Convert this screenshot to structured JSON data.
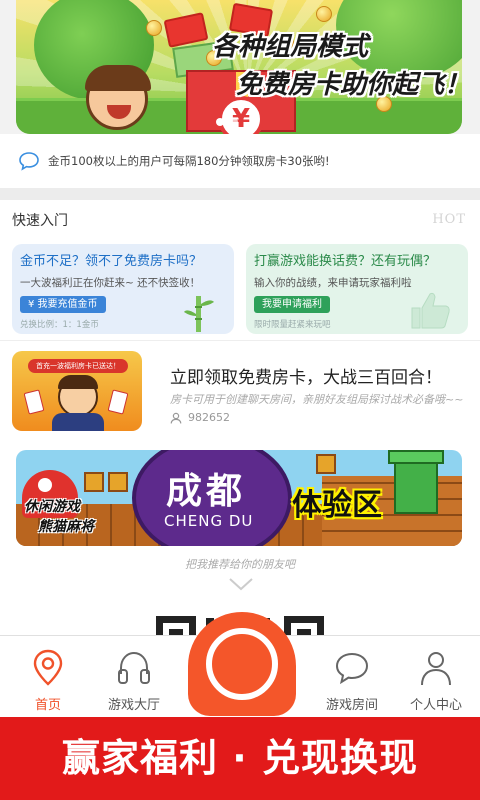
{
  "banner": {
    "title_line1": "各种组局模式",
    "title_line2": "免费房卡助你起飞！",
    "slide_count": 2,
    "active_slide": 1
  },
  "notice": {
    "text": "金币100枚以上的用户可每隔180分钟领取房卡30张哟!"
  },
  "quick_entry": {
    "title": "快速入门",
    "hot_label": "HOT",
    "cards": [
      {
        "title": "金币不足？领不了免费房卡吗？",
        "desc": "一大波福利正在你赶来~ 还不快签收！",
        "button": "¥ 我要充值金币",
        "footnote": "兑换比例：1：1金币",
        "color": "#1e6fc6"
      },
      {
        "title": "打赢游戏能换话费？还有玩偶？",
        "desc": "输入你的战绩，来申请玩家福利啦",
        "button": "我要申请福利",
        "footnote": "限时限量赶紧来玩吧",
        "color": "#2b8a4a"
      }
    ]
  },
  "promo": {
    "image_caption": "首充一波福利房卡已送达！",
    "title": "立即领取免费房卡，大战三百回合！",
    "subtitle": "房卡可用于创建聊天房间，亲朋好友组局探讨战术必备哦~~",
    "player_count": "982652"
  },
  "chengdu_banner": {
    "name_cn": "成都",
    "name_en": "CHENG DU",
    "tag_line1": "休闲游戏",
    "tag_line2": "熊猫麻将",
    "zone_label": "体验区"
  },
  "recommend_text": "把我推荐给你的朋友吧",
  "tabs": {
    "home": "首页",
    "hall": "游戏大厅",
    "room": "游戏房间",
    "me": "个人中心",
    "active": "home"
  },
  "footer": {
    "text": "赢家福利 · 兑现换现"
  },
  "colors": {
    "accent": "#f0522a",
    "footer_red": "#e21a1a"
  }
}
